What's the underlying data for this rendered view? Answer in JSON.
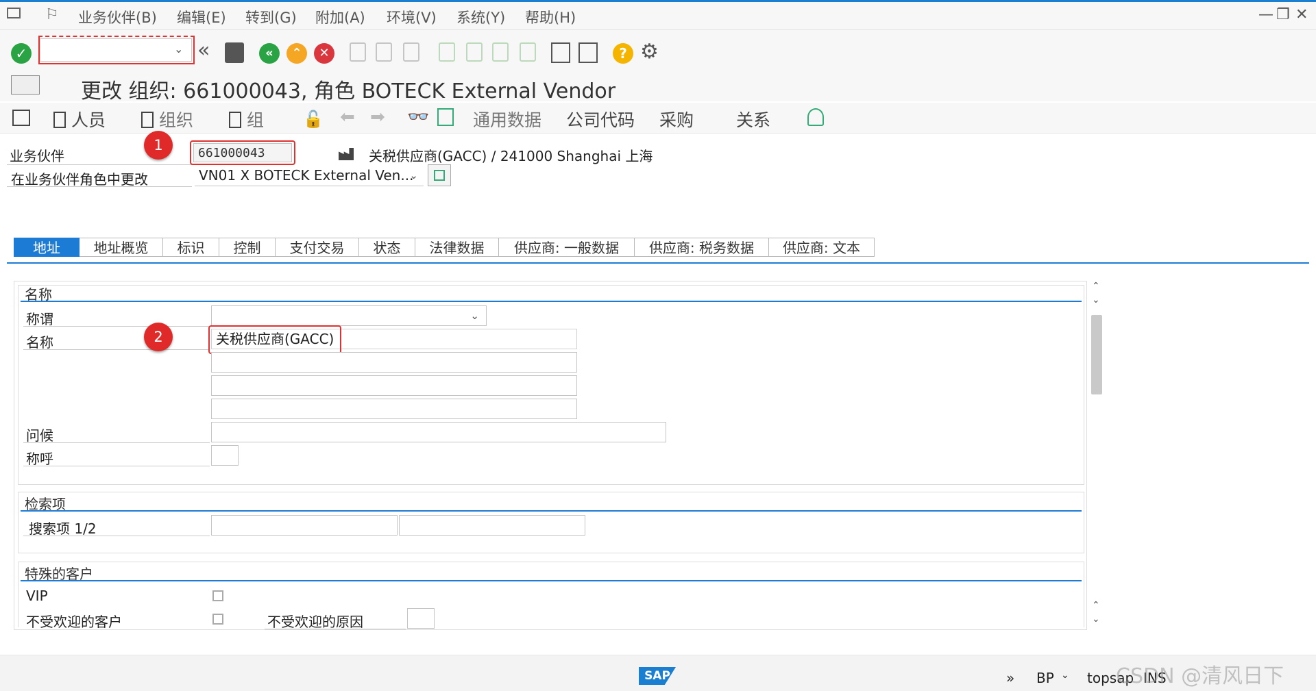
{
  "menubar": {
    "items": [
      "业务伙伴(B)",
      "编辑(E)",
      "转到(G)",
      "附加(A)",
      "环境(V)",
      "系统(Y)",
      "帮助(H)"
    ]
  },
  "toolbar": {
    "command_value": "",
    "icons": [
      "enter-icon",
      "back-double-icon",
      "save-icon",
      "back-icon",
      "exit-icon",
      "cancel-icon",
      "print-icon",
      "find-icon",
      "find-next-icon",
      "first-page-icon",
      "prev-page-icon",
      "next-page-icon",
      "last-page-icon",
      "new-session-icon",
      "shortcut-icon",
      "help-icon",
      "settings-icon"
    ]
  },
  "title": "更改 组织: 661000043, 角色 BOTECK External Vendor",
  "app_toolbar": {
    "person": "人员",
    "org": "组织",
    "group": "组",
    "general_data": "通用数据",
    "company_code": "公司代码",
    "purchasing": "采购",
    "relationships": "关系"
  },
  "header": {
    "bp_label": "业务伙伴",
    "bp_value": "661000043",
    "bp_desc": "关税供应商(GACC) / 241000 Shanghai 上海",
    "role_label": "在业务伙伴角色中更改",
    "role_value": "VN01  X BOTECK External Ven..."
  },
  "annotations": {
    "badge1": "1",
    "badge2": "2"
  },
  "tabs": [
    "地址",
    "地址概览",
    "标识",
    "控制",
    "支付交易",
    "状态",
    "法律数据",
    "供应商: 一般数据",
    "供应商: 税务数据",
    "供应商: 文本"
  ],
  "name_group": {
    "header": "名称",
    "title_label": "称谓",
    "title_value": "",
    "name_label": "名称",
    "name1": "关税供应商(GACC)",
    "name2": "",
    "name3": "",
    "name4": "",
    "greeting_label": "问候",
    "greeting_value": "",
    "salutation_label": "称呼",
    "salutation_value": ""
  },
  "search_group": {
    "header": "检索项",
    "label": "搜索项 1/2",
    "value1": "",
    "value2": ""
  },
  "special_group": {
    "header": "特殊的客户",
    "vip_label": "VIP",
    "vip_checked": false,
    "unwanted_label": "不受欢迎的客户",
    "unwanted_checked": false,
    "reason_label": "不受欢迎的原因",
    "reason_value": ""
  },
  "statusbar": {
    "sap_logo": "SAP",
    "transaction": "BP",
    "system": "topsap",
    "mode": "INS"
  },
  "watermark": "CSDN @清风日下",
  "colors": {
    "accent": "#1c7cd5",
    "annotation_red": "#e02a2a",
    "ok_green": "#2aa345",
    "warn_orange": "#f5a623",
    "cancel_red": "#d9363e"
  }
}
